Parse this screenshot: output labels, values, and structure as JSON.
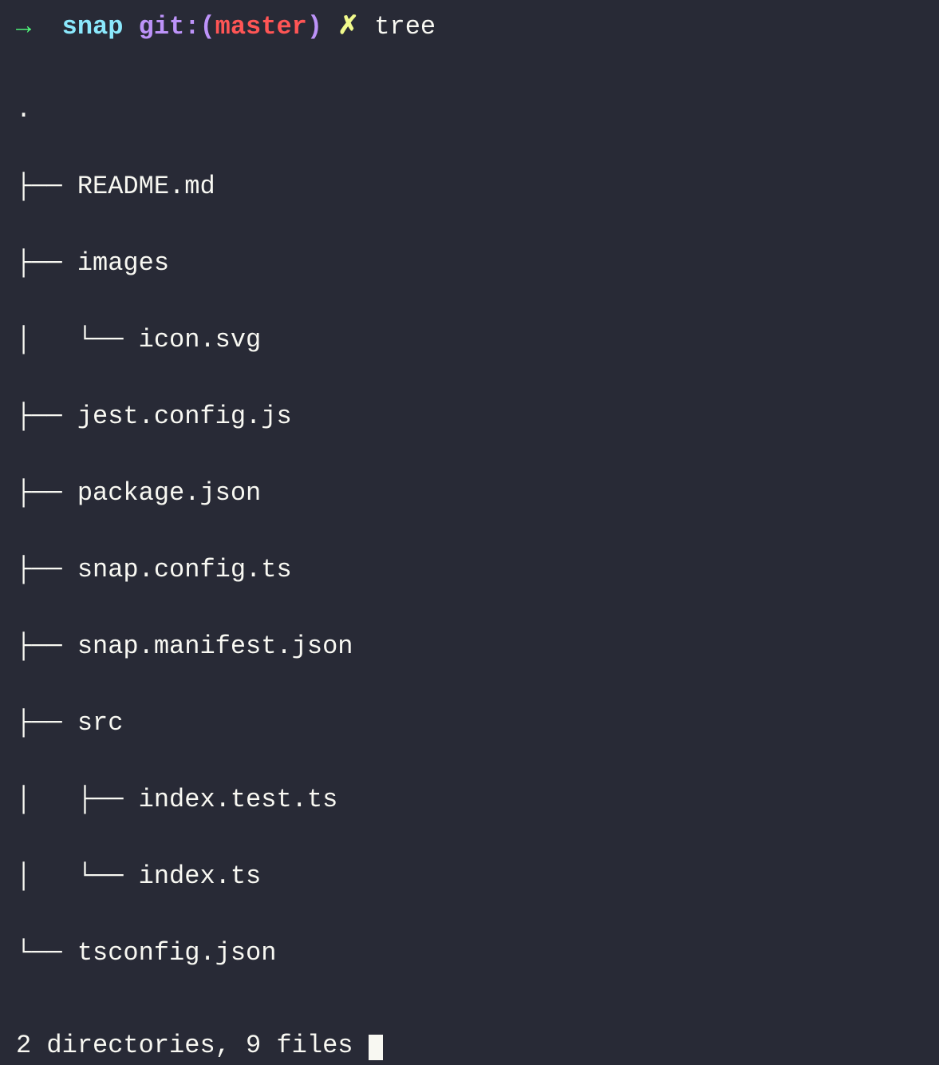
{
  "prompt": {
    "arrow": "→",
    "cwd": "snap",
    "git_label": "git:",
    "git_paren_open": "(",
    "git_branch": "master",
    "git_paren_close": ")",
    "dirty_marker": "✗",
    "command": "tree"
  },
  "tree": {
    "root": ".",
    "lines": [
      "├── README.md",
      "├── images",
      "│   └── icon.svg",
      "├── jest.config.js",
      "├── package.json",
      "├── snap.config.ts",
      "├── snap.manifest.json",
      "├── src",
      "│   ├── index.test.ts",
      "│   └── index.ts",
      "└── tsconfig.json"
    ]
  },
  "summary": "2 directories, 9 files"
}
